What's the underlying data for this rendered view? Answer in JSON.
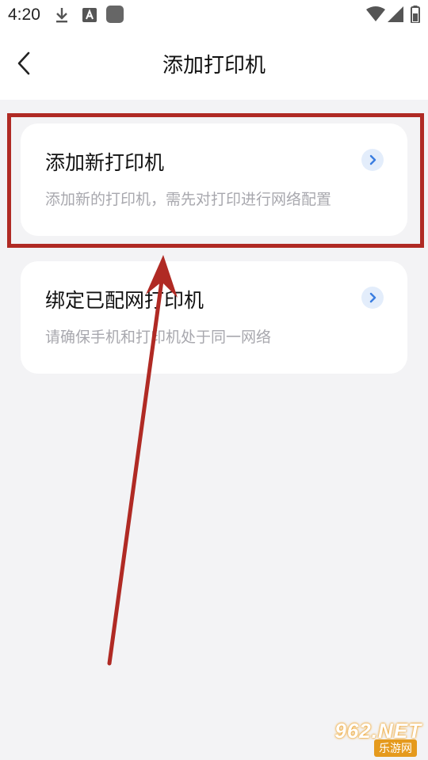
{
  "status_bar": {
    "time": "4:20",
    "left_icons": [
      "download-icon",
      "a-badge-icon",
      "app-square-icon"
    ],
    "right_icons": [
      "wifi-icon",
      "cellular-icon",
      "battery-icon"
    ]
  },
  "header": {
    "title": "添加打印机",
    "back_icon": "chevron-left-icon"
  },
  "cards": [
    {
      "title": "添加新打印机",
      "subtitle": "添加新的打印机，需先对打印进行网络配置",
      "icon": "chevron-right-icon"
    },
    {
      "title": "绑定已配网打印机",
      "subtitle": "请确保手机和打印机处于同一网络",
      "icon": "chevron-right-icon"
    }
  ],
  "annotation": {
    "color": "#b02a24"
  },
  "watermark": {
    "brand": "962.NET",
    "sub": "乐游网"
  },
  "colors": {
    "background": "#f3f3f5",
    "card": "#ffffff",
    "accent": "#3a7de0",
    "chevron_bg": "#e3edfb"
  }
}
